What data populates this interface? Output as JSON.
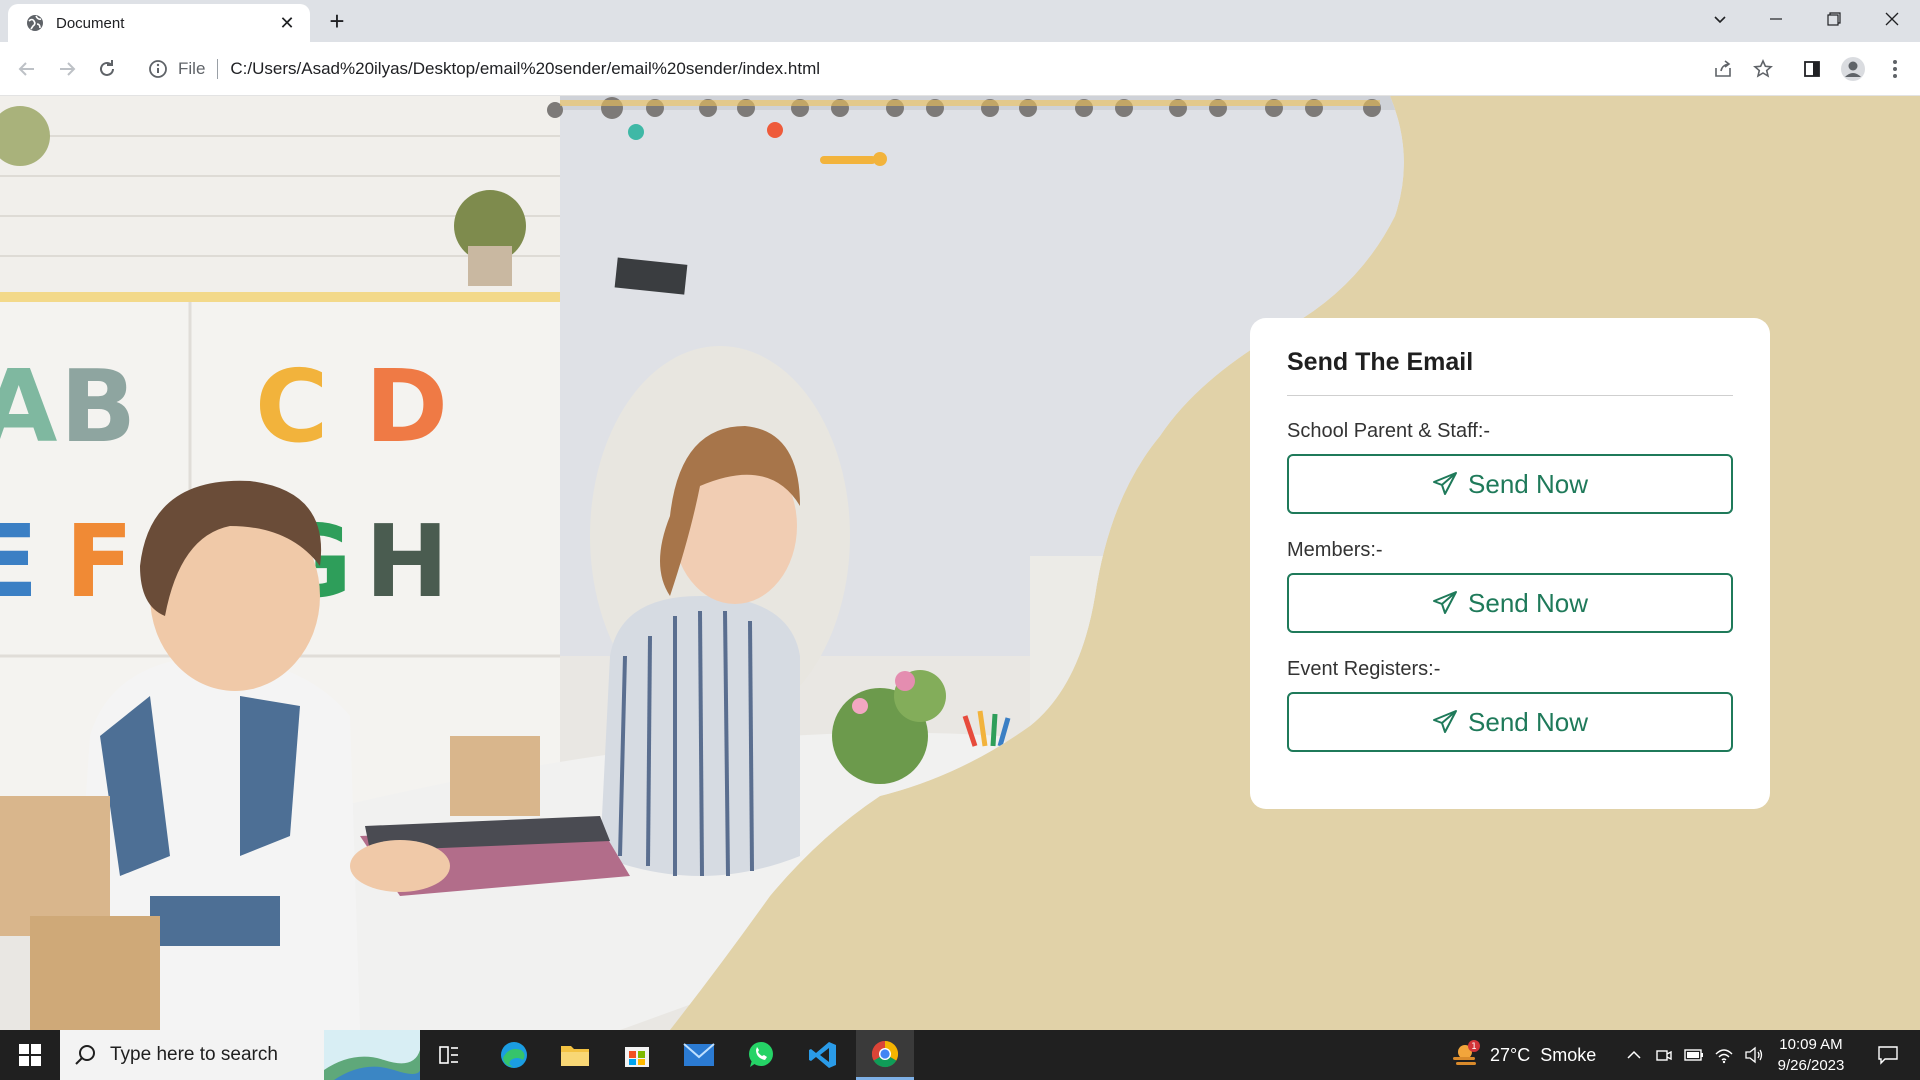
{
  "browser": {
    "tab_title": "Document",
    "tab_close": "✕",
    "new_tab": "+",
    "address_scheme_label": "File",
    "address_url": "C:/Users/Asad%20ilyas/Desktop/email%20sender/email%20sender/index.html"
  },
  "card": {
    "title": "Send The Email",
    "groups": [
      {
        "label": "School Parent & Staff:-",
        "button": "Send Now"
      },
      {
        "label": "Members:-",
        "button": "Send Now"
      },
      {
        "label": "Event Registers:-",
        "button": "Send Now"
      }
    ]
  },
  "taskbar": {
    "search_placeholder": "Type here to search",
    "weather": "27°C  Smoke",
    "weather_badge": "1",
    "time": "10:09 AM",
    "date": "9/26/2023"
  },
  "colors": {
    "page_background": "#e1d2a8",
    "accent_green": "#1f7a5a",
    "card": "#ffffff",
    "taskbar": "#202020"
  }
}
